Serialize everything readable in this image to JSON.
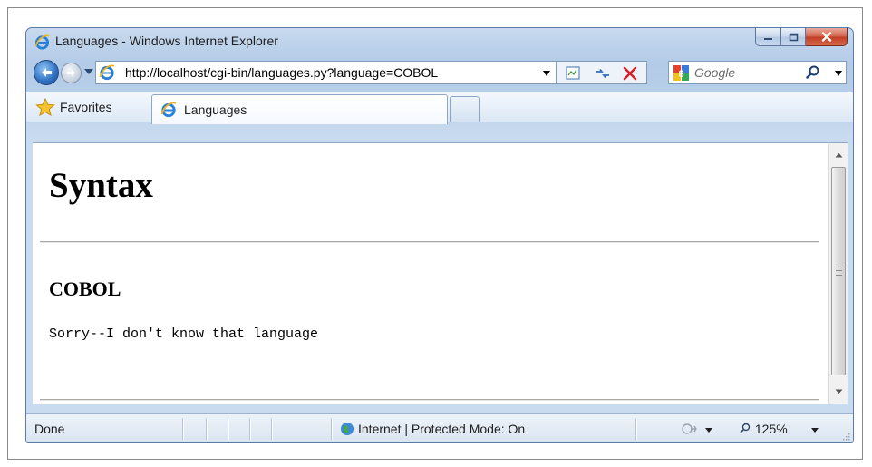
{
  "window": {
    "title": "Languages - Windows Internet Explorer"
  },
  "address_bar": {
    "url": "http://localhost/cgi-bin/languages.py?language=COBOL",
    "search_placeholder": "Google"
  },
  "favorites_bar": {
    "favorites_label": "Favorites",
    "tab_label": "Languages"
  },
  "page": {
    "heading": "Syntax",
    "subheading": "COBOL",
    "message": "Sorry--I don't know that language"
  },
  "status_bar": {
    "status": "Done",
    "zone": "Internet | Protected Mode: On",
    "zoom": "125%"
  },
  "icons": {
    "title": "ie-logo-icon",
    "back": "back-arrow-icon",
    "forward": "forward-arrow-icon",
    "compat": "compatibility-view-icon",
    "refresh": "refresh-icon",
    "stop": "stop-icon",
    "search_provider": "google-logo-icon",
    "search": "magnifier-icon",
    "favorites": "star-icon",
    "zone": "globe-icon",
    "zoom": "magnifier-zoom-icon"
  },
  "colors": {
    "frame": "#b8cfe9",
    "close_button": "#c33c21",
    "stop_icon": "#d2232a"
  }
}
